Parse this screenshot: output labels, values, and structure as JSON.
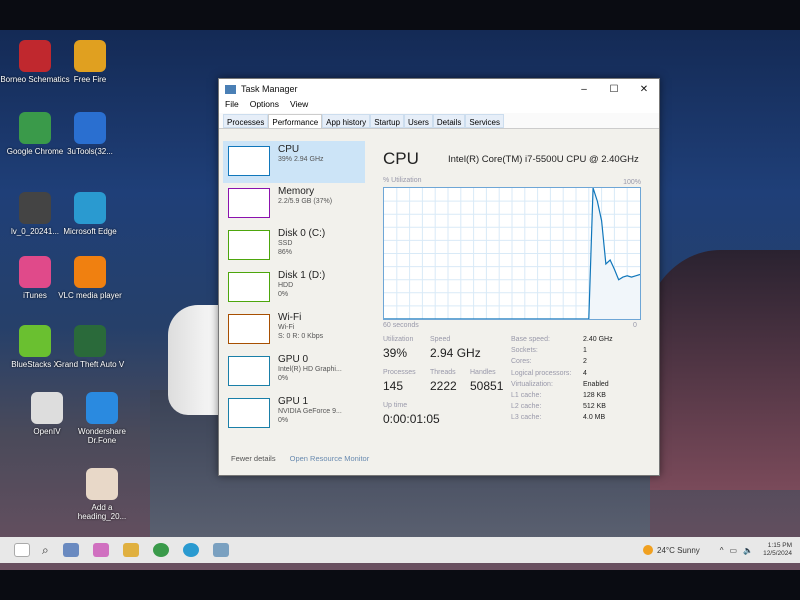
{
  "desktop": {
    "icons": [
      {
        "label": "Borneo Schematics",
        "color": "#c0282e"
      },
      {
        "label": "Free Fire",
        "color": "#e0a020"
      },
      {
        "label": "Google Chrome",
        "color": "#3a9a4a"
      },
      {
        "label": "3uTools(32...",
        "color": "#2a6fd0"
      },
      {
        "label": "lv_0_20241...",
        "color": "#444"
      },
      {
        "label": "Microsoft Edge",
        "color": "#2a9ad0"
      },
      {
        "label": "iTunes",
        "color": "#e04a8a"
      },
      {
        "label": "VLC media player",
        "color": "#f08010"
      },
      {
        "label": "BlueStacks X",
        "color": "#6ac030"
      },
      {
        "label": "Grand Theft Auto V",
        "color": "#2a6a3a"
      },
      {
        "label": "OpenIV",
        "color": "#ddd"
      },
      {
        "label": "Wondershare Dr.Fone",
        "color": "#2a8ae0"
      },
      {
        "label": "Add a heading_20...",
        "color": "#e8d8c8"
      }
    ]
  },
  "window": {
    "title": "Task Manager",
    "controls": {
      "minimize": "–",
      "maximize": "☐",
      "close": "✕"
    },
    "menu": [
      "File",
      "Options",
      "View"
    ],
    "tabs": [
      "Processes",
      "Performance",
      "App history",
      "Startup",
      "Users",
      "Details",
      "Services"
    ],
    "active_tab": "Performance"
  },
  "sidebar": [
    {
      "name": "CPU",
      "sub1": "39% 2.94 GHz",
      "sub2": "",
      "color": "#1177bb",
      "active": true
    },
    {
      "name": "Memory",
      "sub1": "2.2/5.9 GB (37%)",
      "sub2": "",
      "color": "#8b12ae"
    },
    {
      "name": "Disk 0 (C:)",
      "sub1": "SSD",
      "sub2": "86%",
      "color": "#4da60c"
    },
    {
      "name": "Disk 1 (D:)",
      "sub1": "HDD",
      "sub2": "0%",
      "color": "#4da60c"
    },
    {
      "name": "Wi-Fi",
      "sub1": "Wi-Fi",
      "sub2": "S: 0 R: 0 Kbps",
      "color": "#a74f01"
    },
    {
      "name": "GPU 0",
      "sub1": "Intel(R) HD Graphi...",
      "sub2": "0%",
      "color": "#1a7fa8"
    },
    {
      "name": "GPU 1",
      "sub1": "NVIDIA GeForce 9...",
      "sub2": "0%",
      "color": "#1a7fa8"
    }
  ],
  "main": {
    "title": "CPU",
    "cpu_name": "Intel(R) Core(TM) i7-5500U CPU @ 2.40GHz",
    "graph": {
      "ylabel": "% Utilization",
      "ymax_label": "100%",
      "xlabel": "60 seconds",
      "xmin_label": "0",
      "color": "#1177bb",
      "seconds_ago": [
        60,
        12,
        11,
        10,
        9,
        8,
        7,
        6,
        5,
        4,
        3,
        2,
        1,
        0
      ],
      "utilization": [
        0,
        0,
        100,
        90,
        75,
        42,
        45,
        38,
        30,
        32,
        33,
        32,
        33,
        34
      ]
    },
    "stats": {
      "utilization_label": "Utilization",
      "utilization": "39%",
      "speed_label": "Speed",
      "speed": "2.94 GHz",
      "processes_label": "Processes",
      "processes": "145",
      "threads_label": "Threads",
      "threads": "2222",
      "handles_label": "Handles",
      "handles": "50851",
      "uptime_label": "Up time",
      "uptime": "0:00:01:05"
    },
    "specs": [
      {
        "k": "Base speed:",
        "v": "2.40 GHz"
      },
      {
        "k": "Sockets:",
        "v": "1"
      },
      {
        "k": "Cores:",
        "v": "2"
      },
      {
        "k": "Logical processors:",
        "v": "4"
      },
      {
        "k": "Virtualization:",
        "v": "Enabled"
      },
      {
        "k": "L1 cache:",
        "v": "128 KB"
      },
      {
        "k": "L2 cache:",
        "v": "512 KB"
      },
      {
        "k": "L3 cache:",
        "v": "4.0 MB"
      }
    ]
  },
  "footer": {
    "fewer": "Fewer details",
    "monitor": "Open Resource Monitor"
  },
  "taskbar": {
    "weather": "24°C  Sunny",
    "time": "1:15 PM",
    "date": "12/5/2024"
  }
}
